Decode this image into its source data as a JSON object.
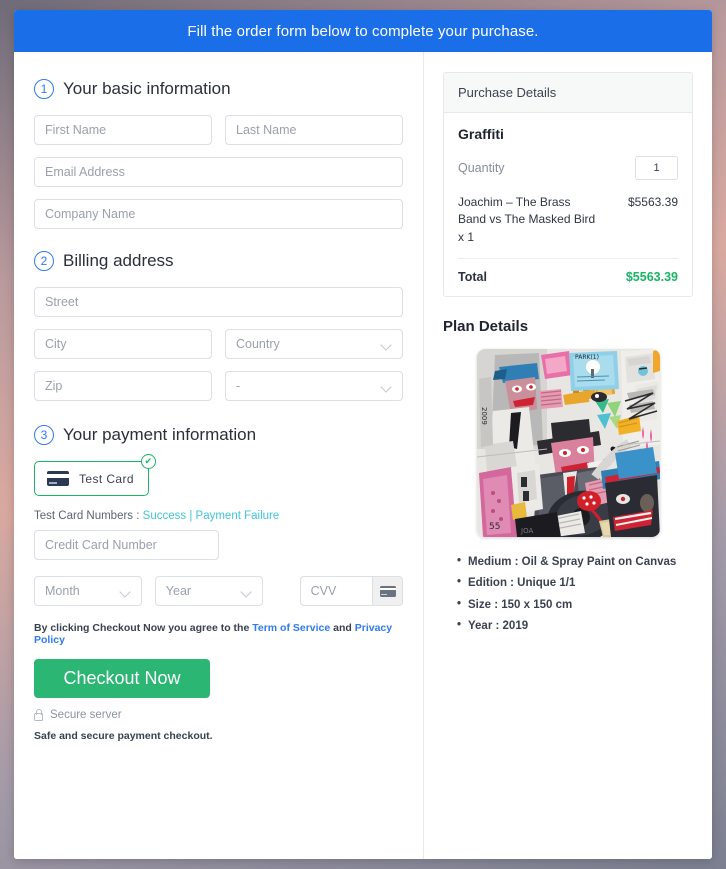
{
  "banner": {
    "text": "Fill the order form below to complete your purchase."
  },
  "form": {
    "step1": {
      "number": "1",
      "title": "Your basic information",
      "fields": {
        "first_name": "First Name",
        "last_name": "Last Name",
        "email": "Email Address",
        "company": "Company Name"
      }
    },
    "step2": {
      "number": "2",
      "title": "Billing address",
      "fields": {
        "street": "Street",
        "city": "City",
        "country": "Country",
        "zip": "Zip",
        "state": "-"
      }
    },
    "step3": {
      "number": "3",
      "title": "Your payment information",
      "method": {
        "label": "Test Card",
        "icon": "credit-card-icon",
        "selected_mark": "✔"
      },
      "test_cards": {
        "prefix": "Test Card Numbers :",
        "success": "Success",
        "separator": "|",
        "failure": "Payment Failure"
      },
      "fields": {
        "card_number": "Credit Card Number",
        "month": "Month",
        "year": "Year",
        "cvv": "CVV"
      }
    },
    "terms": {
      "prefix": "By clicking Checkout Now you agree to the",
      "tos": "Term of Service",
      "conjunction": "and",
      "privacy": "Privacy Policy"
    },
    "checkout_button": "Checkout Now",
    "secure_server": "Secure server",
    "safe_note": "Safe and secure payment checkout."
  },
  "purchase": {
    "header": "Purchase Details",
    "item_title": "Graffiti",
    "quantity_label": "Quantity",
    "quantity_value": "1",
    "line_item": {
      "description": "Joachim – The Brass Band vs The Masked Bird x 1",
      "price": "$5563.39"
    },
    "total_label": "Total",
    "total_value": "$5563.39"
  },
  "plan": {
    "title": "Plan Details",
    "artwork_alt": "graffiti-painting-jazz-band",
    "details": [
      "Medium : Oil & Spray Paint on Canvas",
      "Edition : Unique 1/1",
      "Size : 150 x 150 cm",
      "Year : 2019"
    ]
  },
  "colors": {
    "banner_blue": "#1a6fe8",
    "accent_blue": "#2f7bf0",
    "success_green": "#18b566",
    "button_green": "#2bb673",
    "link_cyan": "#3fc5d8"
  }
}
